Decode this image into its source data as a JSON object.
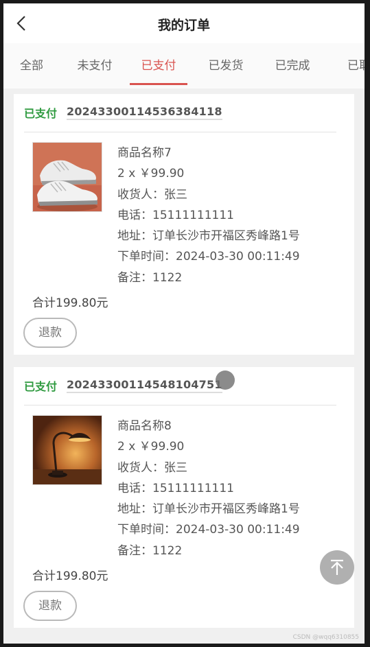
{
  "header": {
    "title": "我的订单",
    "back_icon": "chevron-left-icon"
  },
  "tabs": [
    {
      "label": "全部",
      "active": false
    },
    {
      "label": "未支付",
      "active": false
    },
    {
      "label": "已支付",
      "active": true
    },
    {
      "label": "已发货",
      "active": false
    },
    {
      "label": "已完成",
      "active": false
    },
    {
      "label": "已取",
      "active": false
    }
  ],
  "colors": {
    "accent": "#d9534f",
    "status_green": "#2e9a3f"
  },
  "orders": [
    {
      "status": "已支付",
      "order_no": "20243300114536384118",
      "product_image": "sneakers-image",
      "lines": [
        "商品名称7",
        "2 x ￥99.90",
        "收货人：张三",
        "电话：15111111111",
        "地址：订单长沙市开福区秀峰路1号",
        "下单时间：2024-03-30 00:11:49",
        "备注：1122"
      ],
      "total": "合计199.80元",
      "refund_label": "退款"
    },
    {
      "status": "已支付",
      "order_no": "20243300114548104751",
      "product_image": "desk-lamp-image",
      "lines": [
        "商品名称8",
        "2 x ￥99.90",
        "收货人：张三",
        "电话：15111111111",
        "地址：订单长沙市开福区秀峰路1号",
        "下单时间：2024-03-30 00:11:49",
        "备注：1122"
      ],
      "total": "合计199.80元",
      "refund_label": "退款"
    }
  ],
  "back_to_top_icon": "arrow-up-icon",
  "watermark": "CSDN @wqq6310855"
}
